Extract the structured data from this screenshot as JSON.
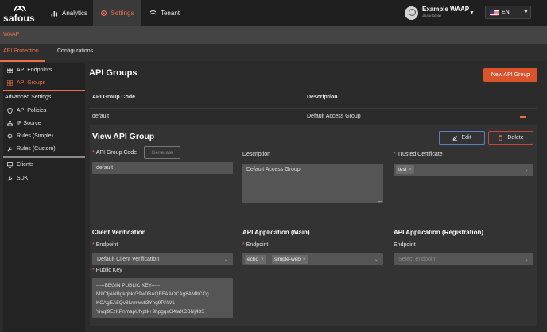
{
  "app": {
    "brand": "safous",
    "nav_tabs": [
      {
        "label": "Analytics",
        "icon": "bar-chart-icon"
      },
      {
        "label": "Settings",
        "icon": "gear-icon",
        "active": true
      },
      {
        "label": "Tenant",
        "icon": "tenant-icon"
      }
    ],
    "user": {
      "name": "Example WAAP",
      "status": "Available"
    },
    "language": {
      "code": "EN",
      "flag": "us-flag-icon"
    }
  },
  "section_bar": {
    "label": "WAAP"
  },
  "sub_tabs": [
    {
      "label": "API Protection",
      "active": true
    },
    {
      "label": "Configurations"
    }
  ],
  "sidebar": {
    "items": [
      {
        "label": "API Endpoints",
        "icon": "grid-icon"
      },
      {
        "label": "API Groups",
        "icon": "grid-icon",
        "active": true
      }
    ],
    "advanced_header": "Advanced Settings",
    "advanced_items": [
      {
        "label": "API Policies",
        "icon": "shield-icon"
      },
      {
        "label": "IP Source",
        "icon": "network-icon"
      },
      {
        "label": "Rules (Simple)",
        "icon": "gear-icon"
      },
      {
        "label": "Rules (Custom)",
        "icon": "wrench-icon"
      }
    ],
    "bottom_items": [
      {
        "label": "Clients",
        "icon": "monitor-icon"
      },
      {
        "label": "SDK",
        "icon": "wrench-icon"
      }
    ]
  },
  "main": {
    "title": "API Groups",
    "new_button": "New API Group",
    "table": {
      "columns": [
        "API Group Code",
        "Description"
      ],
      "rows": [
        {
          "code": "default",
          "description": "Default Access Group"
        }
      ]
    }
  },
  "view_panel": {
    "title": "View API Group",
    "edit_button": "Edit",
    "delete_button": "Delete",
    "group_code": {
      "label": "API Group Code",
      "value": "default",
      "generate_button": "Generate"
    },
    "description": {
      "label": "Description",
      "value": "Default Access Group"
    },
    "trusted_certificate": {
      "label": "Trusted Certificate",
      "tags": [
        "test"
      ]
    },
    "client_verification": {
      "title": "Client Verification",
      "endpoint_label": "Endpoint",
      "endpoint_value": "Default Client Verification",
      "public_key_label": "Public Key",
      "public_key_lines": [
        "-----BEGIN PUBLIC KEY-----",
        "MIICIjANBgkqhkiG9w0BAQEFAAOCAg8AMIICCg",
        "KCAgEA5Qv3Lrmwuti3Yhg9PAW1",
        "Yivql9EzKPnmapUNptk+9hpgqxG4faXCBhij43S"
      ]
    },
    "api_app_main": {
      "title": "API Application (Main)",
      "endpoint_label": "Endpoint",
      "tags": [
        "echo",
        "simple-web"
      ]
    },
    "api_app_registration": {
      "title": "API Application (Registration)",
      "endpoint_label": "Endpoint",
      "placeholder": "Select endpoint"
    }
  },
  "colors": {
    "accent": "#e8704a",
    "primary_button": "#d9532c",
    "edit_border": "#5a7fc6",
    "delete_border": "#c9453a"
  }
}
